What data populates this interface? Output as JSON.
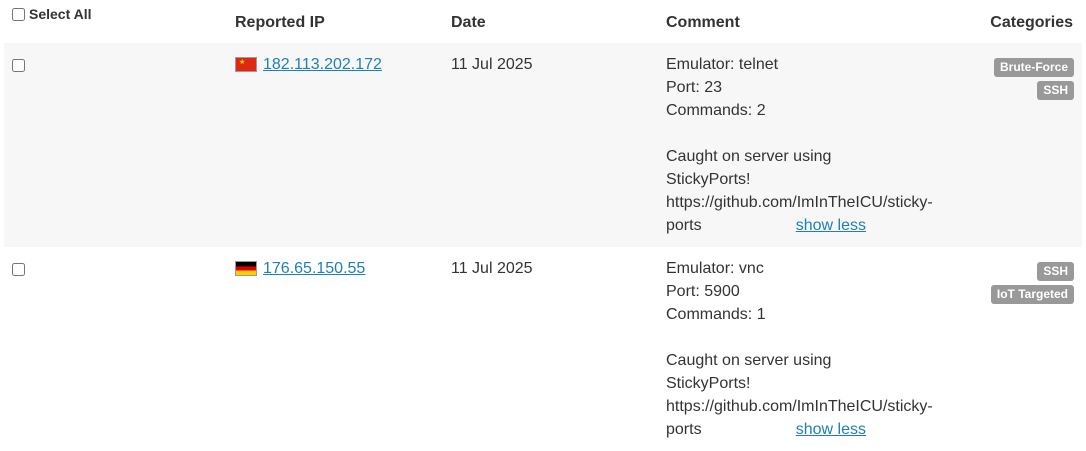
{
  "header": {
    "select_all": "Select All",
    "reported_ip": "Reported IP",
    "date": "Date",
    "comment": "Comment",
    "categories": "Categories"
  },
  "rows": [
    {
      "flag": "china-flag-icon",
      "ip": "182.113.202.172",
      "date": "11 Jul 2025",
      "comment_lines": "Emulator: telnet\nPort: 23\nCommands: 2\n\nCaught on server using\nStickyPorts!\nhttps://github.com/ImInTheICU/sticky-",
      "comment_tail": "ports",
      "show_less": "show less",
      "categories": [
        "Brute-Force",
        "SSH"
      ]
    },
    {
      "flag": "germany-flag-icon",
      "ip": "176.65.150.55",
      "date": "11 Jul 2025",
      "comment_lines": "Emulator: vnc\nPort: 5900\nCommands: 1\n\nCaught on server using\nStickyPorts!\nhttps://github.com/ImInTheICU/sticky-",
      "comment_tail": "ports",
      "show_less": "show less",
      "categories": [
        "SSH",
        "IoT Targeted"
      ]
    }
  ]
}
